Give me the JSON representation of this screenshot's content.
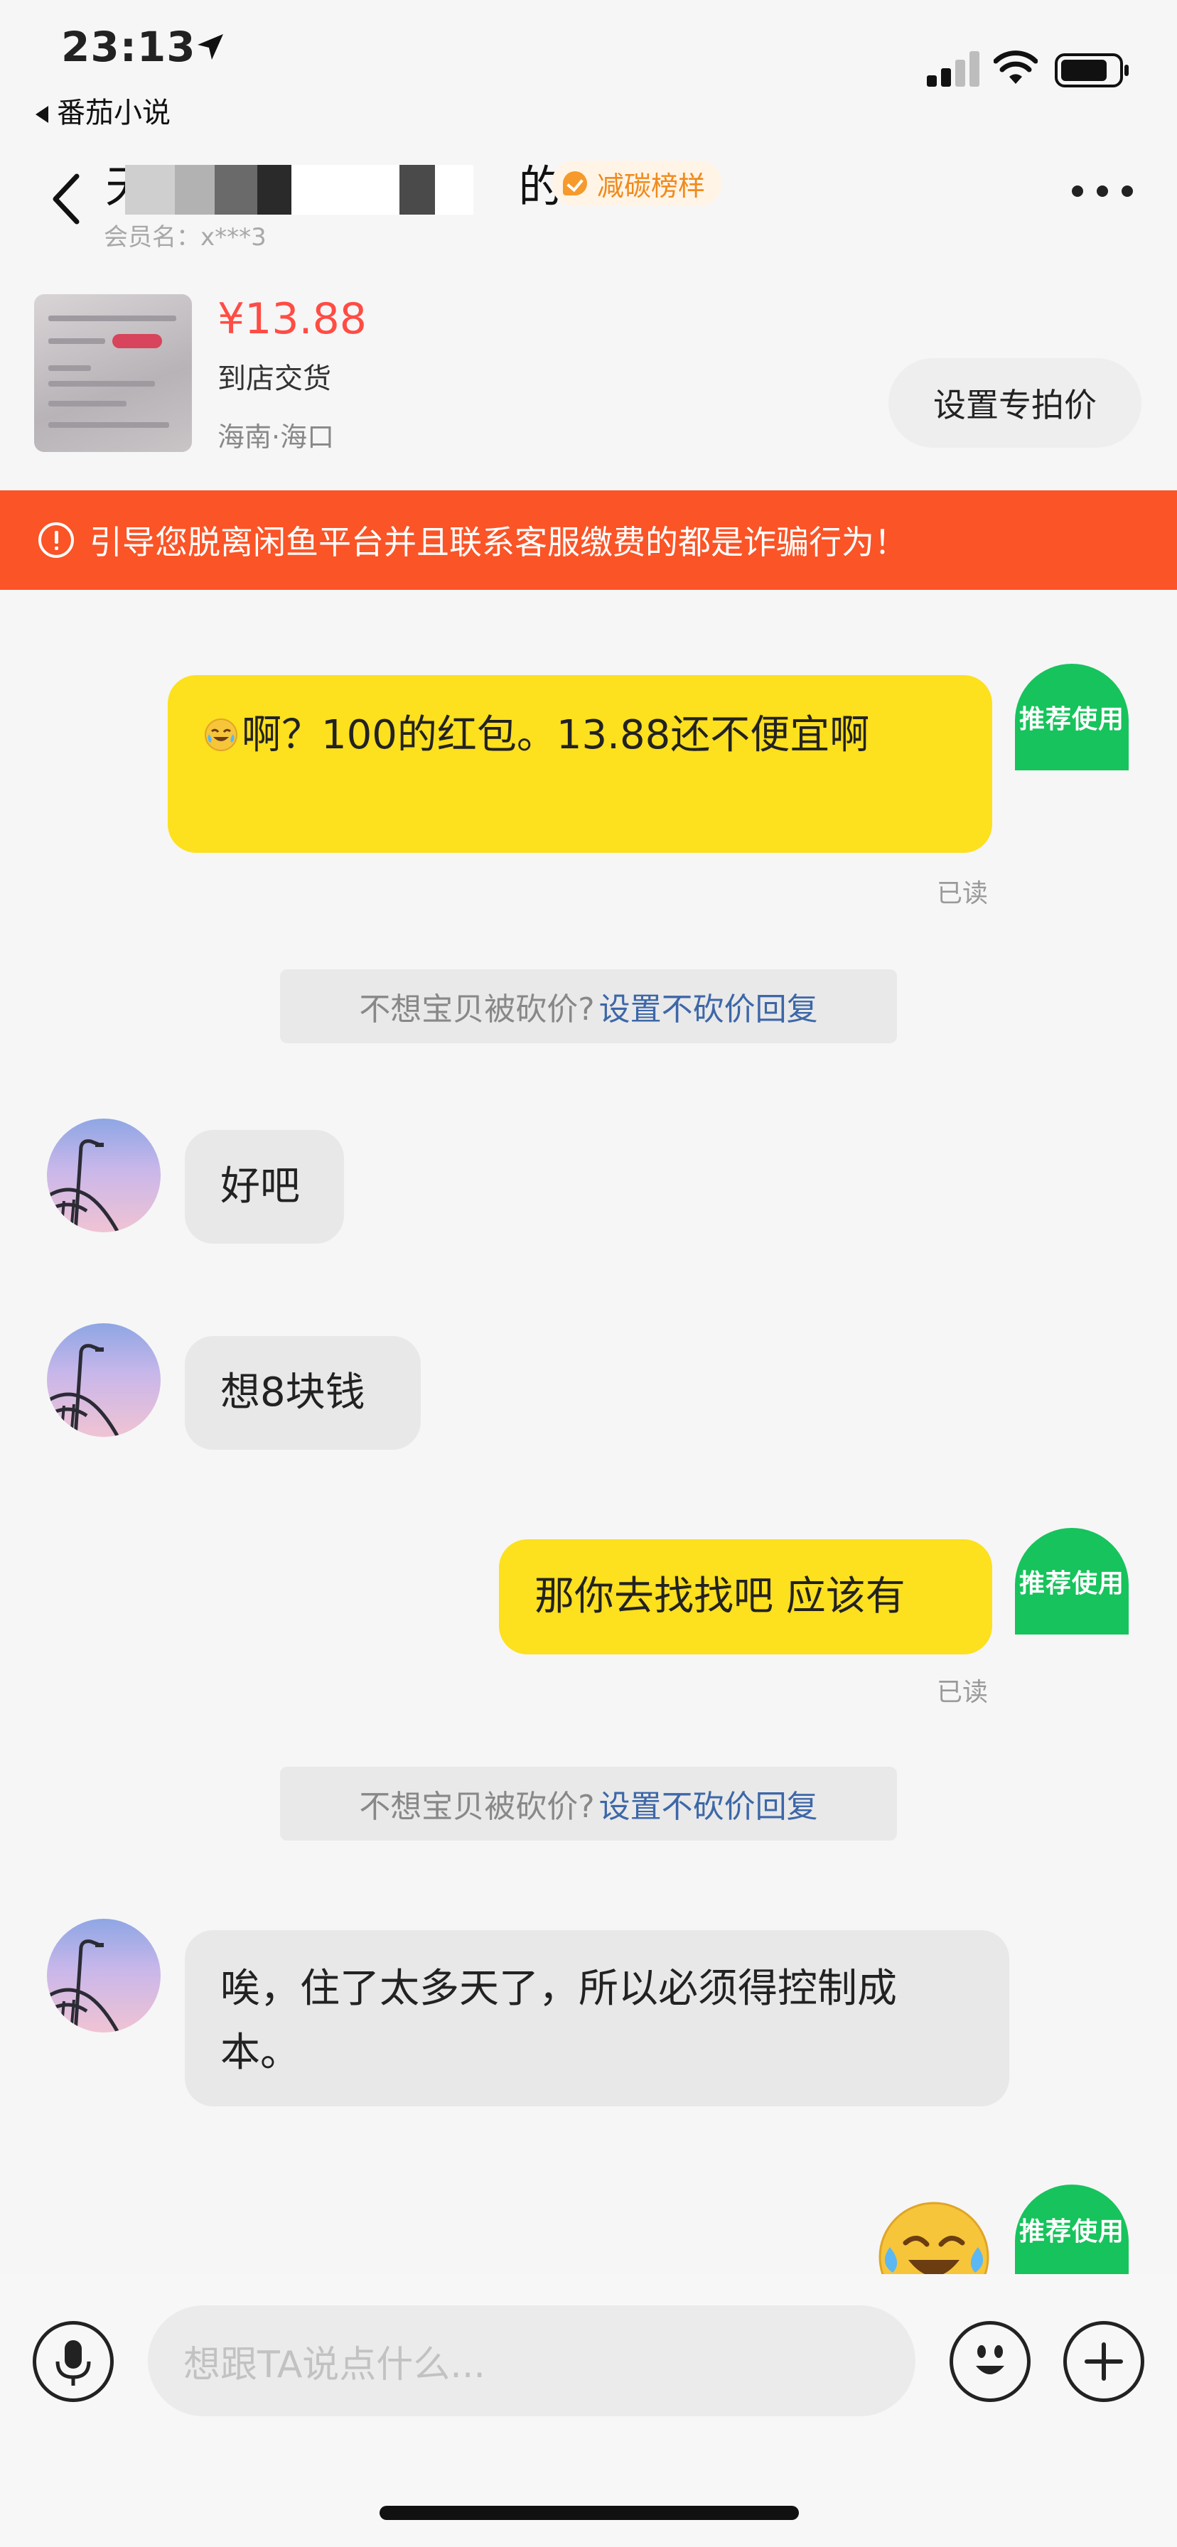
{
  "status_bar": {
    "time": "23:13",
    "back_app": "番茄小说"
  },
  "header": {
    "title_prefix": "天",
    "title_suffix": "的",
    "badge": "减碳榜样",
    "member": "会员名：x***3"
  },
  "product": {
    "price": "¥13.88",
    "delivery": "到店交货",
    "location": "海南·海口",
    "set_price_button": "设置专拍价"
  },
  "warning": "引导您脱离闲鱼平台并且联系客服缴费的都是诈骗行为！",
  "messages": [
    {
      "side": "out",
      "text": "啊？100的红包。13.88还不便宜啊",
      "status": "已读",
      "rec_label": "推荐使用"
    },
    {
      "side": "system",
      "text": "不想宝贝被砍价?",
      "link": "设置不砍价回复"
    },
    {
      "side": "in",
      "text": "好吧"
    },
    {
      "side": "in",
      "text": "想8块钱"
    },
    {
      "side": "out",
      "text": "那你去找找吧 应该有",
      "status": "已读",
      "rec_label": "推荐使用"
    },
    {
      "side": "system",
      "text": "不想宝贝被砍价?",
      "link": "设置不砍价回复"
    },
    {
      "side": "in",
      "text": "唉，住了太多天了，所以必须得控制成本。"
    },
    {
      "side": "out",
      "text": "",
      "rec_label": "推荐使用"
    }
  ],
  "input": {
    "placeholder": "想跟TA说点什么..."
  },
  "colors": {
    "accent_yellow": "#fde01e",
    "warning_orange": "#fa5427",
    "price_red": "#ff4c44",
    "rec_green": "#17c35c",
    "link_blue": "#3d67a8"
  },
  "icons": [
    "location-arrow-icon",
    "signal-icon",
    "wifi-icon",
    "battery-icon",
    "back-icon",
    "more-icon",
    "warning-icon",
    "microphone-icon",
    "emoji-icon",
    "plus-icon"
  ]
}
